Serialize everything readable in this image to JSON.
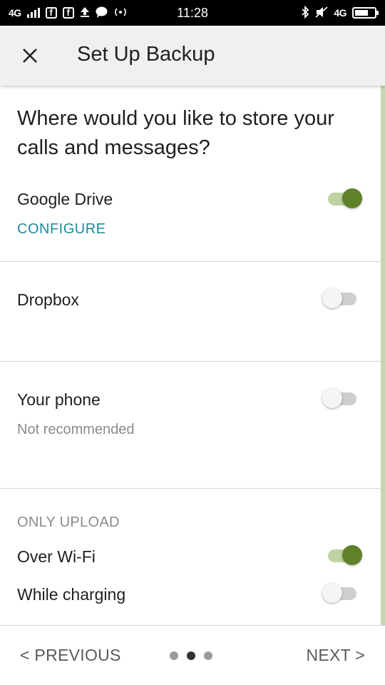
{
  "status_bar": {
    "network_left": "4G",
    "time": "11:28",
    "network_right": "4G",
    "icons": [
      "signal-icon",
      "facebook-icon",
      "facebook-icon",
      "upload-icon",
      "chat-icon",
      "hotspot-icon",
      "bluetooth-icon",
      "mute-icon",
      "battery-icon"
    ]
  },
  "toolbar": {
    "close_icon": "close-icon",
    "title": "Set Up Backup"
  },
  "storage": {
    "question": "Where would you like to store your calls and messages?",
    "google_drive": {
      "label": "Google Drive",
      "enabled": true,
      "configure_label": "CONFIGURE"
    },
    "dropbox": {
      "label": "Dropbox",
      "enabled": false
    },
    "phone": {
      "label": "Your phone",
      "sublabel": "Not recommended",
      "enabled": false
    }
  },
  "upload": {
    "header": "ONLY UPLOAD",
    "wifi": {
      "label": "Over Wi-Fi",
      "enabled": true
    },
    "charging": {
      "label": "While charging",
      "enabled": false
    }
  },
  "bottom_nav": {
    "previous_label": "< PREVIOUS",
    "next_label": "NEXT >",
    "page_count": 3,
    "current_page": 2
  },
  "colors": {
    "accent_green": "#5f8228",
    "link_teal": "#1e8a9c",
    "toolbar_bg": "#f0f0f0"
  }
}
